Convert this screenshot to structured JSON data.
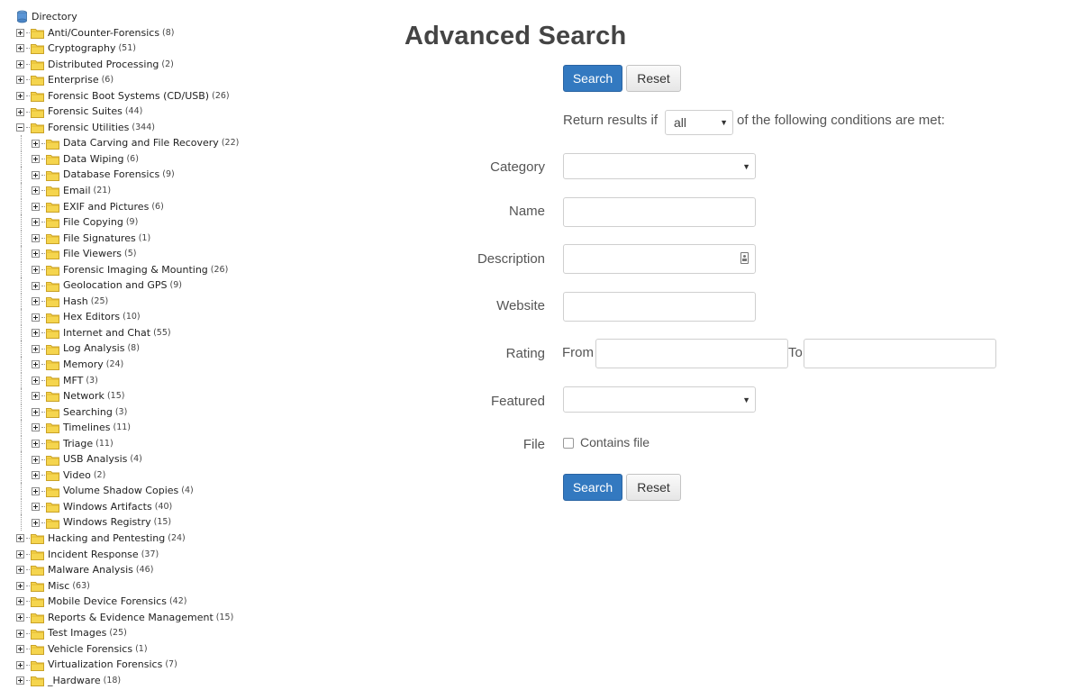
{
  "tree": {
    "root_label": "Directory",
    "items": [
      {
        "label": "Anti/Counter-Forensics",
        "count": "(8)",
        "expanded": false
      },
      {
        "label": "Cryptography",
        "count": "(51)",
        "expanded": false
      },
      {
        "label": "Distributed Processing",
        "count": "(2)",
        "expanded": false
      },
      {
        "label": "Enterprise",
        "count": "(6)",
        "expanded": false
      },
      {
        "label": "Forensic Boot Systems (CD/USB)",
        "count": "(26)",
        "expanded": false
      },
      {
        "label": "Forensic Suites",
        "count": "(44)",
        "expanded": false
      },
      {
        "label": "Forensic Utilities",
        "count": "(344)",
        "expanded": true,
        "children": [
          {
            "label": "Data Carving and File Recovery",
            "count": "(22)"
          },
          {
            "label": "Data Wiping",
            "count": "(6)"
          },
          {
            "label": "Database Forensics",
            "count": "(9)"
          },
          {
            "label": "Email",
            "count": "(21)"
          },
          {
            "label": "EXIF and Pictures",
            "count": "(6)"
          },
          {
            "label": "File Copying",
            "count": "(9)"
          },
          {
            "label": "File Signatures",
            "count": "(1)"
          },
          {
            "label": "File Viewers",
            "count": "(5)"
          },
          {
            "label": "Forensic Imaging & Mounting",
            "count": "(26)"
          },
          {
            "label": "Geolocation and GPS",
            "count": "(9)"
          },
          {
            "label": "Hash",
            "count": "(25)"
          },
          {
            "label": "Hex Editors",
            "count": "(10)"
          },
          {
            "label": "Internet and Chat",
            "count": "(55)"
          },
          {
            "label": "Log Analysis",
            "count": "(8)"
          },
          {
            "label": "Memory",
            "count": "(24)"
          },
          {
            "label": "MFT",
            "count": "(3)"
          },
          {
            "label": "Network",
            "count": "(15)"
          },
          {
            "label": "Searching",
            "count": "(3)"
          },
          {
            "label": "Timelines",
            "count": "(11)"
          },
          {
            "label": "Triage",
            "count": "(11)"
          },
          {
            "label": "USB Analysis",
            "count": "(4)"
          },
          {
            "label": "Video",
            "count": "(2)"
          },
          {
            "label": "Volume Shadow Copies",
            "count": "(4)"
          },
          {
            "label": "Windows Artifacts",
            "count": "(40)"
          },
          {
            "label": "Windows Registry",
            "count": "(15)"
          }
        ]
      },
      {
        "label": "Hacking and Pentesting",
        "count": "(24)",
        "expanded": false
      },
      {
        "label": "Incident Response",
        "count": "(37)",
        "expanded": false
      },
      {
        "label": "Malware Analysis",
        "count": "(46)",
        "expanded": false
      },
      {
        "label": "Misc",
        "count": "(63)",
        "expanded": false
      },
      {
        "label": "Mobile Device Forensics",
        "count": "(42)",
        "expanded": false
      },
      {
        "label": "Reports & Evidence Management",
        "count": "(15)",
        "expanded": false
      },
      {
        "label": "Test Images",
        "count": "(25)",
        "expanded": false
      },
      {
        "label": "Vehicle Forensics",
        "count": "(1)",
        "expanded": false
      },
      {
        "label": "Virtualization Forensics",
        "count": "(7)",
        "expanded": false
      },
      {
        "label": "_Hardware",
        "count": "(18)",
        "expanded": false
      }
    ]
  },
  "page": {
    "title": "Advanced Search"
  },
  "buttons": {
    "search": "Search",
    "reset": "Reset"
  },
  "conditions": {
    "prefix": "Return results if",
    "selected": "all",
    "suffix": "of the following conditions are met:"
  },
  "fields": {
    "category": {
      "label": "Category",
      "value": ""
    },
    "name": {
      "label": "Name",
      "value": ""
    },
    "description": {
      "label": "Description",
      "value": ""
    },
    "website": {
      "label": "Website",
      "value": ""
    },
    "rating": {
      "label": "Rating",
      "from_label": "From",
      "to_label": "To",
      "from_value": "",
      "to_value": ""
    },
    "featured": {
      "label": "Featured",
      "value": ""
    },
    "file": {
      "label": "File",
      "checkbox_label": "Contains file",
      "checked": false
    }
  },
  "colors": {
    "primary_button": "#3379c0",
    "folder_yellow": "#f5d54e",
    "folder_outline": "#c9a227"
  },
  "icons": {
    "root": "directory-icon",
    "folder": "folder-icon",
    "expander": "plus-minus-box-icon",
    "caret": "caret-down-icon"
  }
}
